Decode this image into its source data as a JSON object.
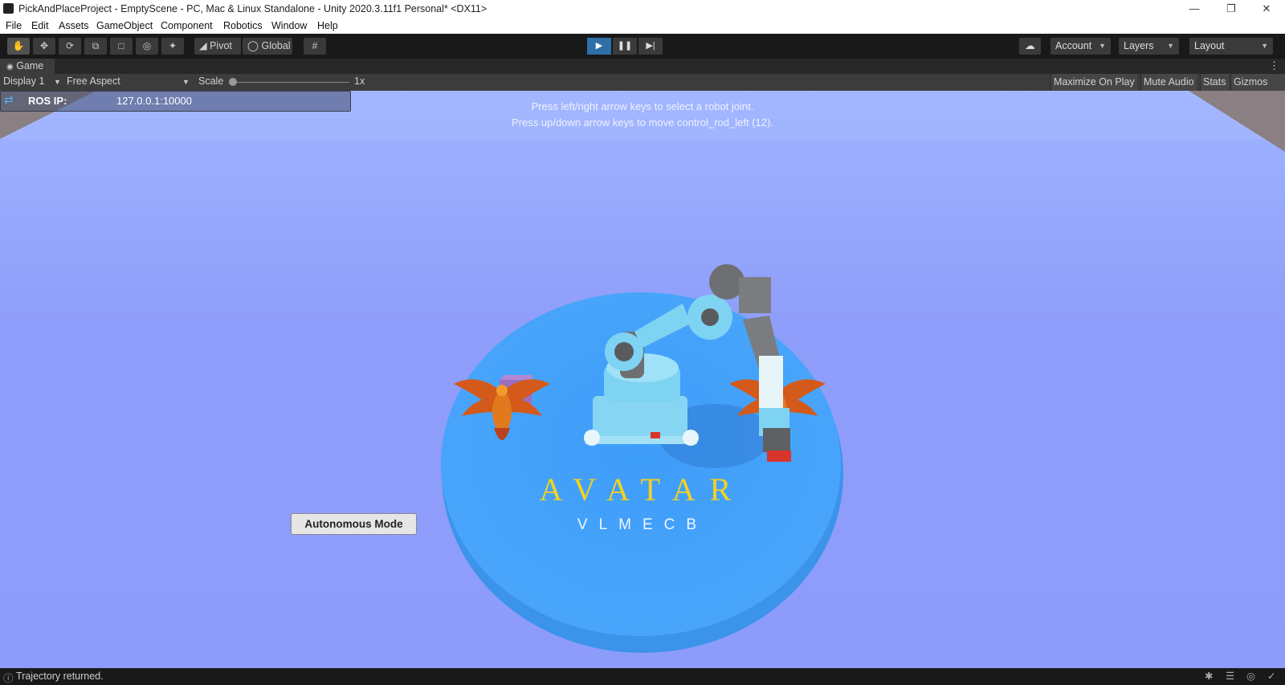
{
  "window": {
    "title": "PickAndPlaceProject - EmptyScene - PC, Mac & Linux Standalone - Unity 2020.3.11f1 Personal* <DX11>",
    "controls": [
      "minimize-icon",
      "restore-icon",
      "close-icon"
    ]
  },
  "menu": [
    "File",
    "Edit",
    "Assets",
    "GameObject",
    "Component",
    "Robotics",
    "Window",
    "Help"
  ],
  "toolbar": {
    "tools": [
      "hand-icon",
      "move-icon",
      "rotate-icon",
      "scale-icon",
      "rect-icon",
      "transform-icon",
      "custom-tool-icon"
    ],
    "pivot_label": "Pivot",
    "global_label": "Global",
    "account_label": "Account",
    "layers_label": "Layers",
    "layout_label": "Layout"
  },
  "game_tab": {
    "label": "Game"
  },
  "game_bar": {
    "display": "Display 1",
    "aspect": "Free Aspect",
    "scale_label": "Scale",
    "scale_value": "1x",
    "maximize": "Maximize On Play",
    "mute": "Mute Audio",
    "stats": "Stats",
    "gizmos": "Gizmos"
  },
  "overlay": {
    "ros_label": "ROS IP:",
    "ros_value": "127.0.0.1:10000",
    "hint1": "Press left/right arrow keys to select a robot joint.",
    "hint2": "Press up/down arrow keys to move control_rod_left (12).",
    "autonomous_button": "Autonomous Mode",
    "table_title": "AVATAR",
    "table_subtitle": "VLMECB"
  },
  "status": {
    "text": "Trajectory returned."
  },
  "colors": {
    "sky": "#9aacfd",
    "table": "#4aa6fb",
    "robot": "#7fd3f2",
    "logo_text": "#f4d21f",
    "play_active": "#2f6fa8"
  }
}
